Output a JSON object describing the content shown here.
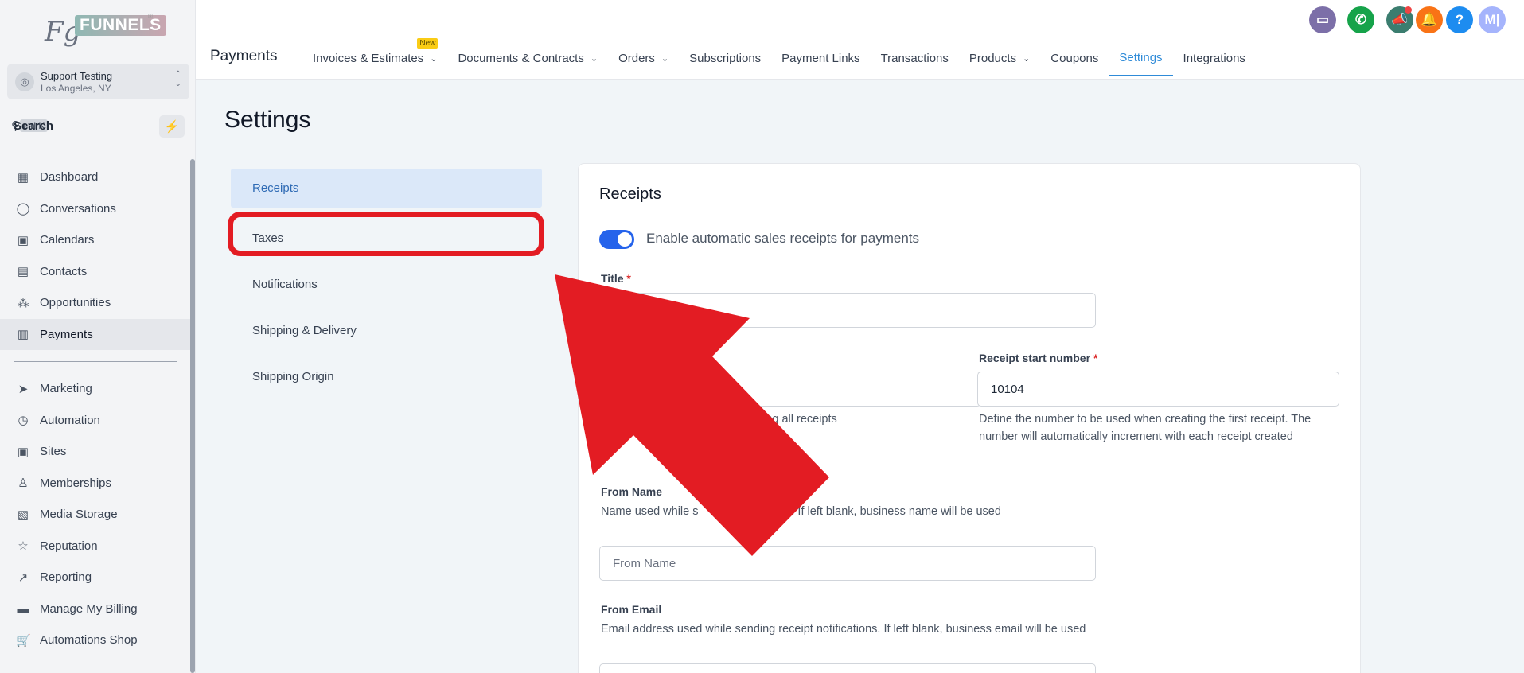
{
  "brand": {
    "logo_fg": "Fg",
    "logo_funnels": "FUNNELS",
    "logo_reg": "®"
  },
  "account": {
    "name": "Support Testing",
    "location": "Los Angeles, NY"
  },
  "search": {
    "label": "Search",
    "shortcut": "ctrl K"
  },
  "sidebar": {
    "items": [
      {
        "label": "Dashboard",
        "icon": "dashboard-icon"
      },
      {
        "label": "Conversations",
        "icon": "chat-icon"
      },
      {
        "label": "Calendars",
        "icon": "calendar-icon"
      },
      {
        "label": "Contacts",
        "icon": "contacts-icon"
      },
      {
        "label": "Opportunities",
        "icon": "opportunities-icon"
      },
      {
        "label": "Payments",
        "icon": "payments-icon",
        "active": true
      }
    ],
    "items2": [
      {
        "label": "Marketing",
        "icon": "send-icon"
      },
      {
        "label": "Automation",
        "icon": "automation-icon"
      },
      {
        "label": "Sites",
        "icon": "sites-icon"
      },
      {
        "label": "Memberships",
        "icon": "memberships-icon"
      },
      {
        "label": "Media Storage",
        "icon": "image-icon"
      },
      {
        "label": "Reputation",
        "icon": "star-icon"
      },
      {
        "label": "Reporting",
        "icon": "trend-icon"
      },
      {
        "label": "Manage My Billing",
        "icon": "billing-icon"
      },
      {
        "label": "Automations Shop",
        "icon": "cart-icon"
      }
    ]
  },
  "header": {
    "module": "Payments",
    "tabs": [
      {
        "label": "Invoices & Estimates",
        "dropdown": true,
        "badge": "New"
      },
      {
        "label": "Documents & Contracts",
        "dropdown": true
      },
      {
        "label": "Orders",
        "dropdown": true
      },
      {
        "label": "Subscriptions"
      },
      {
        "label": "Payment Links"
      },
      {
        "label": "Transactions"
      },
      {
        "label": "Products",
        "dropdown": true
      },
      {
        "label": "Coupons"
      },
      {
        "label": "Settings",
        "active": true
      },
      {
        "label": "Integrations"
      }
    ],
    "icons": [
      {
        "name": "chat-widget-icon",
        "color": "#7c6fa8",
        "glyph": "▭"
      },
      {
        "name": "phone-icon",
        "color": "#16a34a",
        "glyph": "✆"
      },
      {
        "name": "megaphone-icon",
        "color": "#3b7d6f",
        "glyph": "📣"
      },
      {
        "name": "bell-icon",
        "color": "#f97316",
        "glyph": "🔔"
      },
      {
        "name": "help-icon",
        "color": "#1d8cf0",
        "glyph": "?"
      },
      {
        "name": "user-avatar",
        "color": "#a5b4fc",
        "glyph": "M|"
      }
    ]
  },
  "page": {
    "title": "Settings"
  },
  "settings_menu": [
    "Receipts",
    "Taxes",
    "Notifications",
    "Shipping & Delivery",
    "Shipping Origin"
  ],
  "receipts": {
    "title": "Receipts",
    "toggle_label": "Enable automatic sales receipts for payments",
    "toggle_on": true,
    "title_label": "Title",
    "start_label": "Receipt start number",
    "start_value": "10104",
    "prefix_desc_visible": "ating all receipts",
    "start_desc": "Define the number to be used when creating the first receipt. The number will automatically increment with each receipt created",
    "from_name_label": "From Name",
    "from_name_desc": "Name used while s          notifications. If left blank, business name will be used",
    "from_name_placeholder": "From Name",
    "from_email_label": "From Email",
    "from_email_desc": "Email address used while sending receipt notifications. If left blank, business email will be used"
  },
  "colors": {
    "accent": "#2f8bd8",
    "annotation": "#e31c23",
    "toggle": "#2563eb"
  }
}
